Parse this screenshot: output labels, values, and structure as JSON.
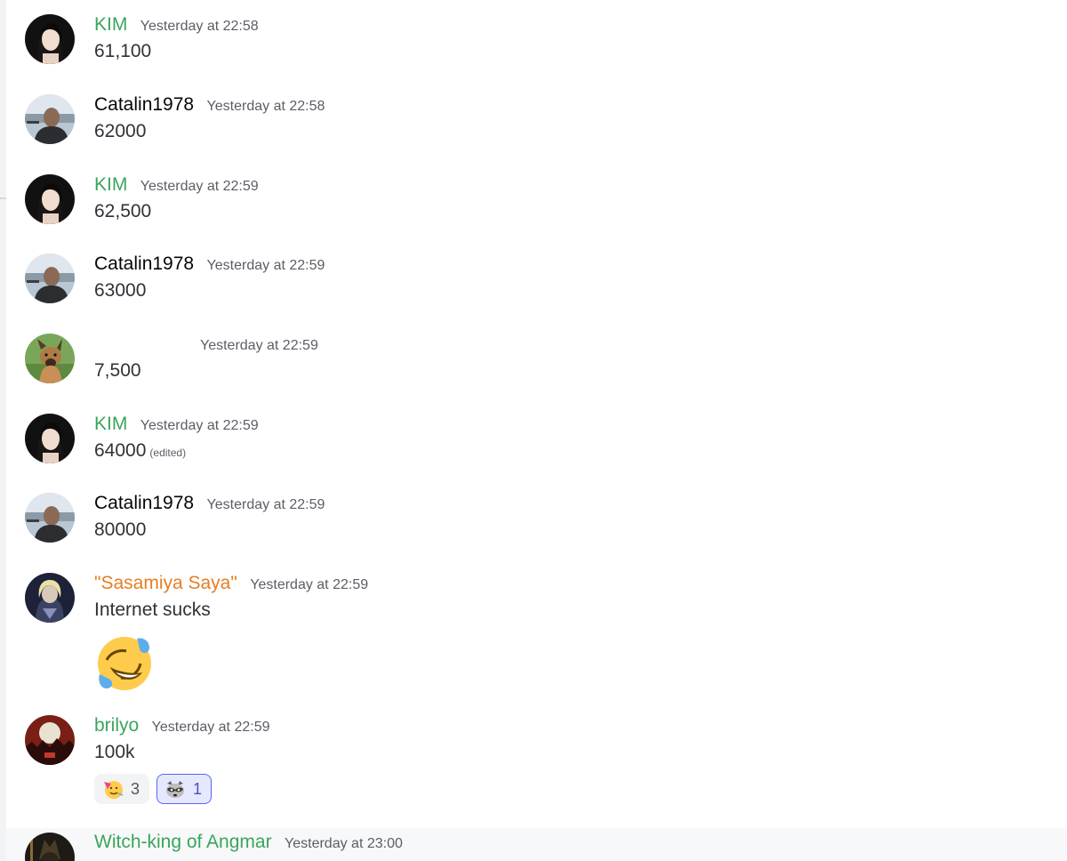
{
  "colors": {
    "kim": "#3ba55c",
    "catalin": "#060607",
    "sasamiya": "#e67e22",
    "brilyo": "#3ba55c",
    "witch": "#3ba55c",
    "timestamp": "#5c5e66"
  },
  "messages": [
    {
      "author": "KIM",
      "timestamp": "Yesterday at 22:58",
      "text": "61,100"
    },
    {
      "author": "Catalin1978",
      "timestamp": "Yesterday at 22:58",
      "text": "62000"
    },
    {
      "author": "KIM",
      "timestamp": "Yesterday at 22:59",
      "text": "62,500"
    },
    {
      "author": "Catalin1978",
      "timestamp": "Yesterday at 22:59",
      "text": "63000"
    },
    {
      "author": "",
      "timestamp": "Yesterday at 22:59",
      "text": "7,500"
    },
    {
      "author": "KIM",
      "timestamp": "Yesterday at 22:59",
      "text": "64000",
      "edited": "(edited)"
    },
    {
      "author": "Catalin1978",
      "timestamp": "Yesterday at 22:59",
      "text": "80000"
    },
    {
      "author": "\"Sasamiya Saya\"",
      "timestamp": "Yesterday at 22:59",
      "text": "Internet sucks",
      "emoji": "rofl-emoji"
    },
    {
      "author": "brilyo",
      "timestamp": "Yesterday at 22:59",
      "text": "100k",
      "reactions": [
        {
          "icon": "partying-face-emoji",
          "count": "3",
          "selected": false
        },
        {
          "icon": "raccoon-emoji",
          "count": "1",
          "selected": true
        }
      ]
    },
    {
      "author": "Witch-king of Angmar",
      "timestamp": "Yesterday at 23:00",
      "text": ""
    }
  ]
}
